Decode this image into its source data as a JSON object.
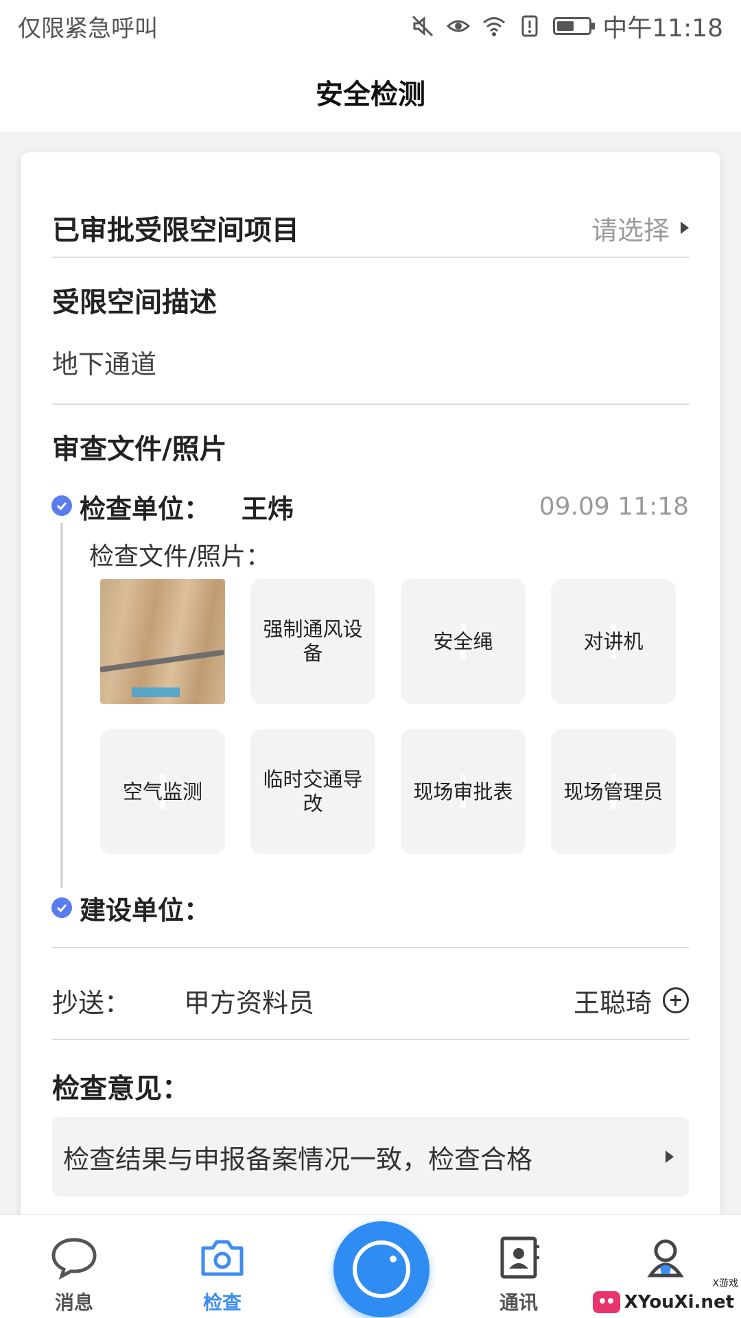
{
  "status_bar": {
    "left_text": "仅限紧急呼叫",
    "time": "中午11:18",
    "battery_level": 0.55
  },
  "header": {
    "title": "安全检测"
  },
  "form": {
    "project": {
      "label": "已审批受限空间项目",
      "placeholder": "请选择"
    },
    "description": {
      "label": "受限空间描述",
      "value": "地下通道"
    },
    "files": {
      "label": "审查文件/照片",
      "inspection_unit": {
        "label": "检查单位：",
        "person": "王炜",
        "time": "09.09 11:18",
        "files_label": "检查文件/照片：",
        "items": [
          "强制通风设备",
          "安全绳",
          "对讲机",
          "空气监测",
          "临时交通导改",
          "现场审批表",
          "现场管理员"
        ]
      },
      "construction_unit": {
        "label": "建设单位："
      }
    },
    "cc": {
      "label": "抄送：",
      "role": "甲方资料员",
      "person": "王聪琦"
    },
    "opinion": {
      "label": "检查意见：",
      "value": "检查结果与申报备案情况一致，检查合格"
    }
  },
  "tabbar": {
    "tabs": [
      {
        "label": "消息",
        "icon": "message-icon"
      },
      {
        "label": "检查",
        "icon": "camera-icon",
        "active": true
      },
      {
        "label": "",
        "icon": "scan-button-icon"
      },
      {
        "label": "通讯",
        "icon": "contacts-icon"
      },
      {
        "label": "",
        "icon": "profile-icon"
      }
    ],
    "accent_color": "#2f8cf2"
  },
  "watermark": {
    "text": "XYouXi.net",
    "small": "X游戏"
  }
}
